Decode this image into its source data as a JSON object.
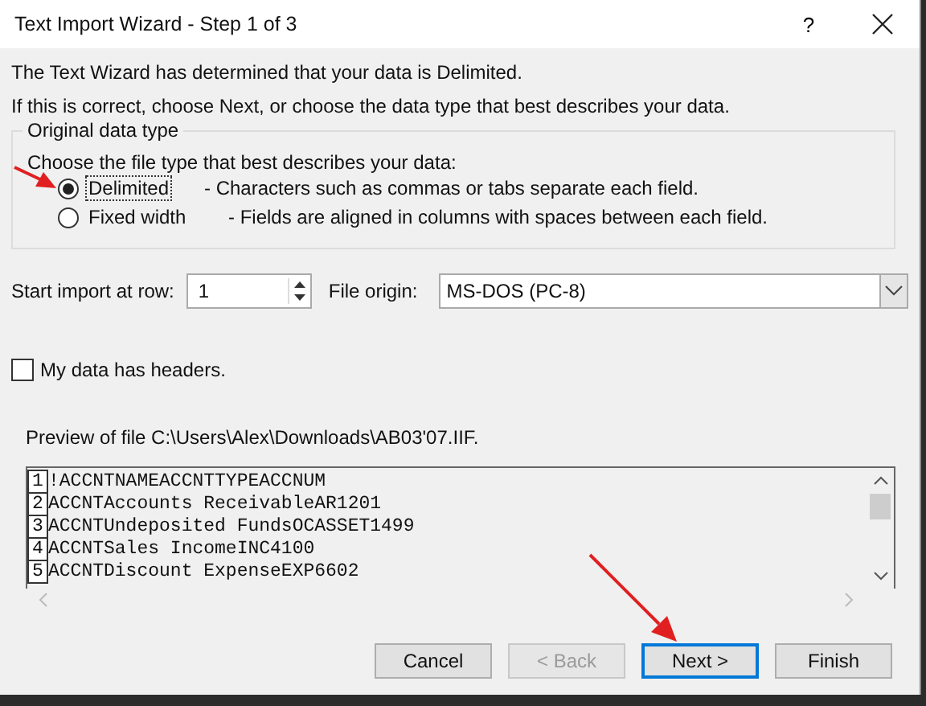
{
  "window": {
    "title": "Text Import Wizard - Step 1 of 3",
    "help": "?"
  },
  "intro": [
    "The Text Wizard has determined that your data is Delimited.",
    "If this is correct, choose Next, or choose the data type that best describes your data."
  ],
  "data_type_group": {
    "title": "Original data type",
    "prompt": "Choose the file type that best describes your data:",
    "options": [
      {
        "label": "Delimited",
        "description": "- Characters such as commas or tabs separate each field.",
        "selected": true
      },
      {
        "label": "Fixed width",
        "description": "- Fields are aligned in columns with spaces between each field.",
        "selected": false
      }
    ]
  },
  "start_row": {
    "label": "Start import at row:",
    "value": "1"
  },
  "file_origin": {
    "label": "File origin:",
    "value": "MS-DOS (PC-8)"
  },
  "headers_checkbox": {
    "label": "My data has headers.",
    "checked": false
  },
  "preview": {
    "label": "Preview of file C:\\Users\\Alex\\Downloads\\AB03'07.IIF.",
    "rows": [
      {
        "number": "1",
        "text": "!ACCNTNAMEACCNTTYPEACCNUM"
      },
      {
        "number": "2",
        "text": "ACCNTAccounts ReceivableAR1201"
      },
      {
        "number": "3",
        "text": "ACCNTUndeposited FundsOCASSET1499"
      },
      {
        "number": "4",
        "text": "ACCNTSales IncomeINC4100"
      },
      {
        "number": "5",
        "text": "ACCNTDiscount ExpenseEXP6602"
      }
    ]
  },
  "buttons": [
    {
      "label": "Cancel",
      "disabled": false,
      "default": false
    },
    {
      "label": "< Back",
      "disabled": true,
      "default": false
    },
    {
      "label": "Next >",
      "disabled": false,
      "default": true
    },
    {
      "label": "Finish",
      "disabled": false,
      "default": false
    }
  ]
}
